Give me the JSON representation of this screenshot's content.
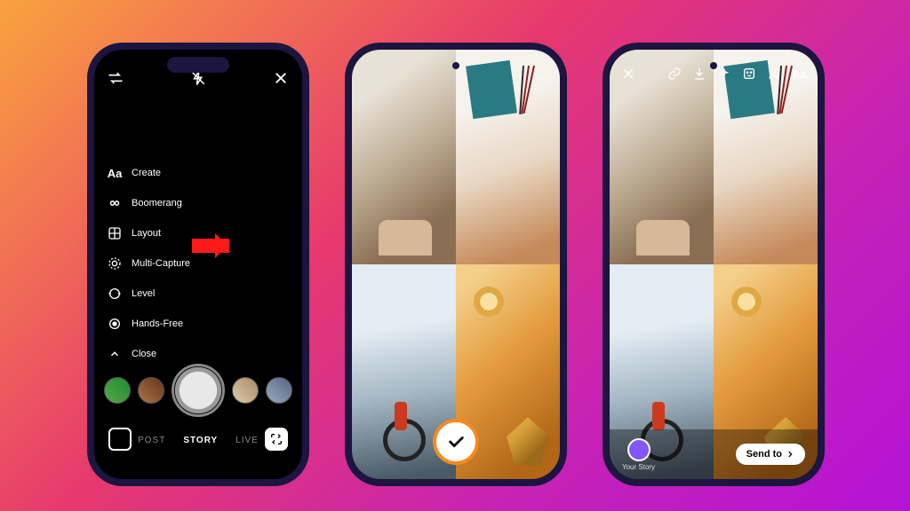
{
  "phone1": {
    "menu": [
      {
        "icon": "text-icon",
        "label": "Create"
      },
      {
        "icon": "infinity-icon",
        "label": "Boomerang"
      },
      {
        "icon": "layout-icon",
        "label": "Layout"
      },
      {
        "icon": "multi-capture-icon",
        "label": "Multi-Capture"
      },
      {
        "icon": "level-icon",
        "label": "Level"
      },
      {
        "icon": "hands-free-icon",
        "label": "Hands-Free"
      },
      {
        "icon": "chevron-down-icon",
        "label": "Close"
      }
    ],
    "modes": {
      "post": "POST",
      "story": "STORY",
      "live": "LIVE"
    },
    "arrow_target": "Layout"
  },
  "phone2": {
    "confirm": "✓"
  },
  "phone3": {
    "toolbar": [
      "close",
      "link",
      "download",
      "sparkle",
      "sticker",
      "draw",
      "text"
    ],
    "text_tool": "Aa",
    "your_story": "Your Story",
    "send": "Send to"
  }
}
